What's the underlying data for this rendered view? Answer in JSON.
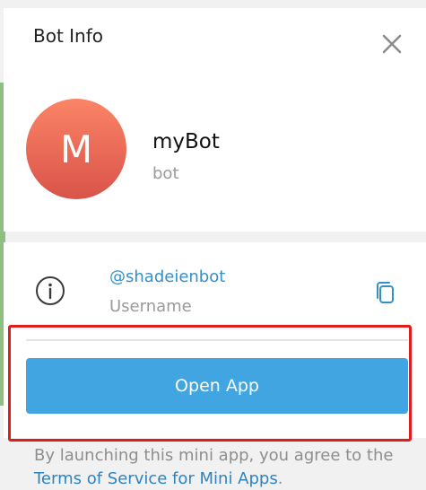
{
  "header": {
    "title": "Bot Info",
    "close_icon": "close-icon"
  },
  "profile": {
    "avatar_letter": "M",
    "name": "myBot",
    "subtitle": "bot",
    "avatar_colors": [
      "#fb8466",
      "#d9534a"
    ]
  },
  "info": {
    "icon": "info-icon",
    "username": "@shadeienbot",
    "username_label": "Username",
    "copy_icon": "copy-icon"
  },
  "action": {
    "open_app_label": "Open App",
    "button_color": "#41a5e1"
  },
  "disclaimer": {
    "text": "By launching this mini app, you agree to the",
    "link_text": "Terms of Service for Mini Apps",
    "link_suffix": "."
  },
  "annotation": {
    "highlight_color": "#e01c1c"
  }
}
